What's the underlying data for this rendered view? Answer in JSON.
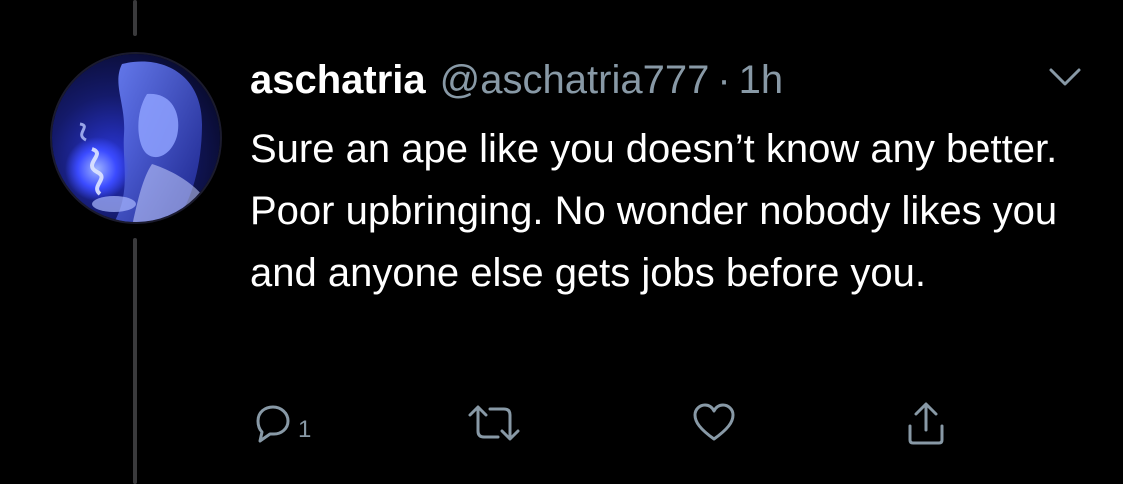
{
  "tweet": {
    "display_name": "aschatria",
    "handle": "@aschatria777",
    "separator": "·",
    "time": "1h",
    "body": "Sure an ape like you doesn’t know any better. Poor upbringing. No wonder nobody likes you and anyone else gets jobs before you."
  },
  "actions": {
    "reply_icon": "reply-icon",
    "reply_count": "1",
    "retweet_icon": "retweet-icon",
    "like_icon": "heart-icon",
    "share_icon": "share-icon"
  },
  "menu": {
    "caret_icon": "chevron-down-icon"
  },
  "colors": {
    "background": "#000000",
    "primary_text": "#ffffff",
    "secondary_text": "#8899a6",
    "thread_line": "#3a3a3c",
    "avatar_glow": "#3b4bff"
  }
}
